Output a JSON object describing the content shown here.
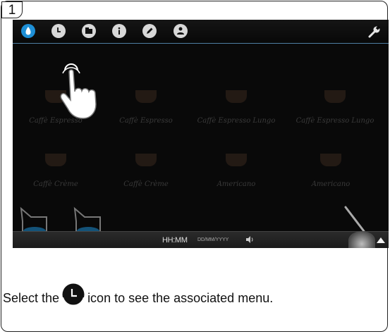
{
  "step": {
    "number": "1"
  },
  "topbar": {
    "icons": [
      {
        "name": "water-drop-icon",
        "active": true
      },
      {
        "name": "clock-icon",
        "active": false
      },
      {
        "name": "cleaning-icon",
        "active": false
      },
      {
        "name": "info-icon",
        "active": false
      },
      {
        "name": "pencil-icon",
        "active": false
      },
      {
        "name": "user-icon",
        "active": false
      }
    ],
    "settings_icon": "wrench-icon",
    "active_color": "#1e8fd6"
  },
  "products": [
    {
      "label": "Caffè Espresso"
    },
    {
      "label": "Caffè Espresso"
    },
    {
      "label": "Caffè Espresso Lungo"
    },
    {
      "label": "Caffè Espresso Lungo"
    },
    {
      "label": "Caffè Crème"
    },
    {
      "label": "Caffè Crème"
    },
    {
      "label": "Americano"
    },
    {
      "label": "Americano"
    }
  ],
  "statusbar": {
    "time": "HH:MM",
    "date": "DD/MM/YYYY",
    "volume_icon": "speaker-icon",
    "expand_icon": "up-arrow-icon"
  },
  "caption": {
    "before": "Select the",
    "icon": "clock-icon",
    "after": "icon to see the associated menu."
  }
}
